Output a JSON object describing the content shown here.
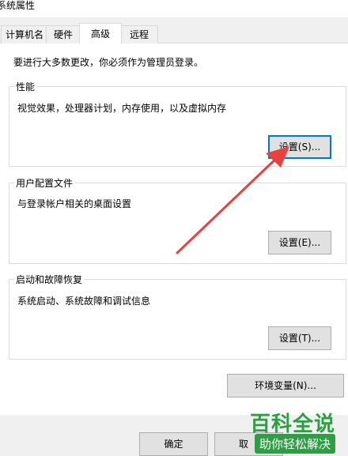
{
  "window": {
    "title": "系统属性"
  },
  "tabs": [
    {
      "label": "计算机名"
    },
    {
      "label": "硬件"
    },
    {
      "label": "高级"
    },
    {
      "label": "远程"
    }
  ],
  "advanced": {
    "admin_notice": "要进行大多数更改，你必须作为管理员登录。",
    "performance": {
      "title": "性能",
      "description": "视觉效果，处理器计划，内存使用，以及虚拟内存",
      "button": "设置(S)..."
    },
    "user_profiles": {
      "title": "用户配置文件",
      "description": "与登录帐户相关的桌面设置",
      "button": "设置(E)..."
    },
    "startup_recovery": {
      "title": "启动和故障恢复",
      "description": "系统启动、系统故障和调试信息",
      "button": "设置(T)..."
    },
    "env_button": "环境变量(N)..."
  },
  "footer": {
    "ok": "确定",
    "cancel": "取"
  },
  "watermark": {
    "brand": "百科全说",
    "tagline": "助你轻松解决"
  },
  "colors": {
    "accent": "#0078d7",
    "arrow": "#e8423f",
    "watermark": "#2e9e44"
  }
}
